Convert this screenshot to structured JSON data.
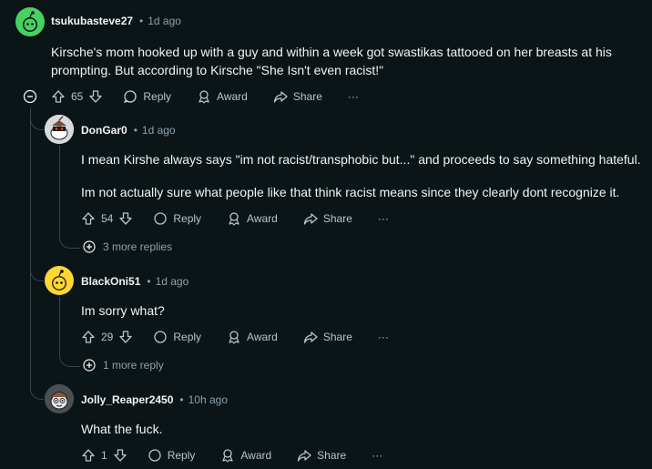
{
  "comments": [
    {
      "user": "tsukubasteve27",
      "time": "1d ago",
      "paragraphs": [
        "Kirsche's mom hooked up with a guy and within a week got swastikas tattooed on her breasts at his",
        "prompting. But according to Kirsche \"She Isn't even racist!\""
      ],
      "votes": "65",
      "avatar_color": "#46d160"
    },
    {
      "user": "DonGar0",
      "time": "1d ago",
      "paragraphs": [
        "I mean Kirshe always says \"im not racist/transphobic but...\" and proceeds to say something hateful.",
        "Im not actually sure what people like that think racist means since they clearly dont recognize it."
      ],
      "votes": "54",
      "more_replies": "3 more replies"
    },
    {
      "user": "BlackOni51",
      "time": "1d ago",
      "paragraphs": [
        "Im sorry what?"
      ],
      "votes": "29",
      "more_replies": "1 more reply",
      "avatar_color": "#ffd635"
    },
    {
      "user": "Jolly_Reaper2450",
      "time": "10h ago",
      "paragraphs": [
        "What the fuck."
      ],
      "votes": "1"
    }
  ],
  "actions": {
    "reply": "Reply",
    "award": "Award",
    "share": "Share",
    "more": "···"
  }
}
